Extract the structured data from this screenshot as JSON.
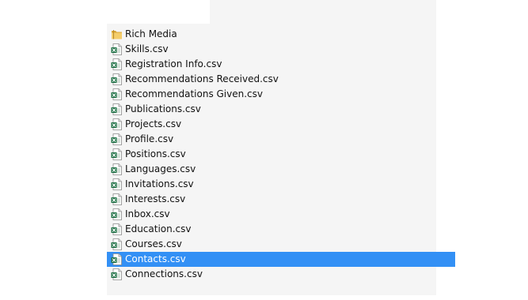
{
  "files": [
    {
      "name": "Rich Media",
      "icon": "folder-icon",
      "type": "folder",
      "selected": false
    },
    {
      "name": "Skills.csv",
      "icon": "excel-csv-icon",
      "type": "csv",
      "selected": false
    },
    {
      "name": "Registration Info.csv",
      "icon": "excel-csv-icon",
      "type": "csv",
      "selected": false
    },
    {
      "name": "Recommendations Received.csv",
      "icon": "excel-csv-icon",
      "type": "csv",
      "selected": false
    },
    {
      "name": "Recommendations Given.csv",
      "icon": "excel-csv-icon",
      "type": "csv",
      "selected": false
    },
    {
      "name": "Publications.csv",
      "icon": "excel-csv-icon",
      "type": "csv",
      "selected": false
    },
    {
      "name": "Projects.csv",
      "icon": "excel-csv-icon",
      "type": "csv",
      "selected": false
    },
    {
      "name": "Profile.csv",
      "icon": "excel-csv-icon",
      "type": "csv",
      "selected": false
    },
    {
      "name": "Positions.csv",
      "icon": "excel-csv-icon",
      "type": "csv",
      "selected": false
    },
    {
      "name": "Languages.csv",
      "icon": "excel-csv-icon",
      "type": "csv",
      "selected": false
    },
    {
      "name": "Invitations.csv",
      "icon": "excel-csv-icon",
      "type": "csv",
      "selected": false
    },
    {
      "name": "Interests.csv",
      "icon": "excel-csv-icon",
      "type": "csv",
      "selected": false
    },
    {
      "name": "Inbox.csv",
      "icon": "excel-csv-icon",
      "type": "csv",
      "selected": false
    },
    {
      "name": "Education.csv",
      "icon": "excel-csv-icon",
      "type": "csv",
      "selected": false
    },
    {
      "name": "Courses.csv",
      "icon": "excel-csv-icon",
      "type": "csv",
      "selected": false
    },
    {
      "name": "Contacts.csv",
      "icon": "excel-csv-icon",
      "type": "csv",
      "selected": true
    },
    {
      "name": "Connections.csv",
      "icon": "excel-csv-icon",
      "type": "csv",
      "selected": false
    }
  ],
  "colors": {
    "selection": "#3390f5",
    "panel": "#f5f5f5",
    "excel_green": "#1e7145",
    "folder_yellow": "#e8b84a"
  }
}
